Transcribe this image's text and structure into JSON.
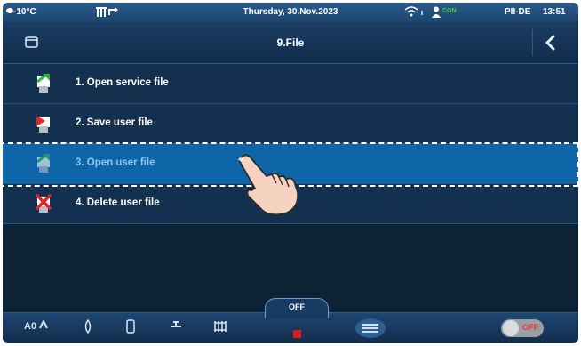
{
  "statusbar": {
    "temperature": "-10°C",
    "date": "Thursday, 30.Nov.2023",
    "connection": "CON",
    "language": "PII-DE",
    "time": "13:51"
  },
  "titlebar": {
    "title": "9.File"
  },
  "menu": {
    "items": [
      {
        "label": "1. Open service file",
        "icon": "open-service-file-icon"
      },
      {
        "label": "2. Save user file",
        "icon": "save-user-file-icon"
      },
      {
        "label": "3. Open user file",
        "icon": "open-user-file-icon",
        "selected": true
      },
      {
        "label": "4. Delete user file",
        "icon": "delete-user-file-icon"
      }
    ]
  },
  "bottombar": {
    "mode_label": "A0",
    "off_label": "OFF",
    "toggle_state": "OFF"
  },
  "colors": {
    "background": "#0e2236",
    "selected_row": "#0e66a9",
    "stop": "#e01b1b",
    "toggle_off": "#e73a2a"
  }
}
